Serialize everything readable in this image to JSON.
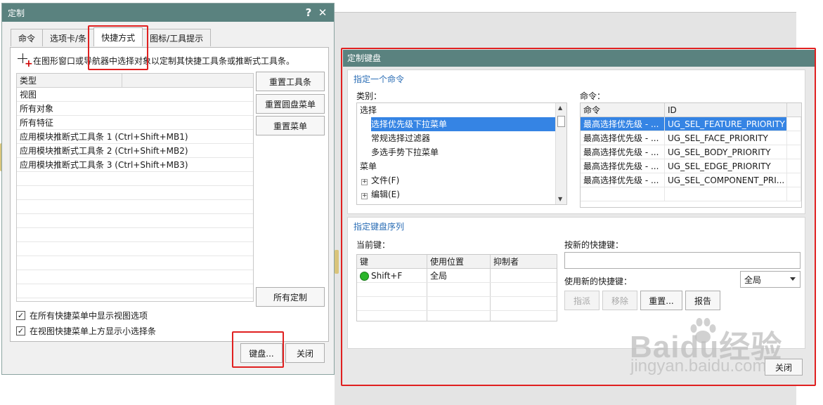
{
  "left_dialog": {
    "title": "定制",
    "help_icon": "?",
    "close_icon": "✕",
    "tabs": [
      "命令",
      "选项卡/条",
      "快捷方式",
      "图标/工具提示"
    ],
    "active_tab": "快捷方式",
    "hint": "在图形窗口或导航器中选择对象以定制其快捷工具条或推断式工具条。",
    "list_header": "类型",
    "list_items": [
      "视图",
      "所有对象",
      "所有特征",
      "应用模块推断式工具条 1 (Ctrl+Shift+MB1)",
      "应用模块推断式工具条 2 (Ctrl+Shift+MB2)",
      "应用模块推断式工具条 3 (Ctrl+Shift+MB3)"
    ],
    "buttons": {
      "reset_toolbar": "重置工具条",
      "reset_radial_menu": "重置圆盘菜单",
      "reset_menu": "重置菜单",
      "all_custom": "所有定制",
      "keyboard": "键盘...",
      "close": "关闭"
    },
    "checkboxes": [
      {
        "label": "在所有快捷菜单中显示视图选项",
        "checked": "✓"
      },
      {
        "label": "在视图快捷菜单上方显示小选择条",
        "checked": "✓"
      }
    ]
  },
  "right_dialog": {
    "title": "定制键盘",
    "assign_group_title": "指定一个命令",
    "category_label": "类别：",
    "command_label": "命令：",
    "tree_items": [
      {
        "text": "选择",
        "level": 0,
        "expander": ""
      },
      {
        "text": "选择优先级下拉菜单",
        "level": 1,
        "expander": "",
        "selected": true
      },
      {
        "text": "常规选择过滤器",
        "level": 1,
        "expander": ""
      },
      {
        "text": "多选手势下拉菜单",
        "level": 1,
        "expander": ""
      },
      {
        "text": "菜单",
        "level": 0,
        "expander": ""
      },
      {
        "text": "文件(F)",
        "level": 1,
        "expander": "+"
      },
      {
        "text": "编辑(E)",
        "level": 1,
        "expander": "+"
      }
    ],
    "cmd_headers": [
      "命令",
      "ID"
    ],
    "commands": [
      {
        "name": "最高选择优先级 - ...",
        "id": "UG_SEL_FEATURE_PRIORITY",
        "selected": true
      },
      {
        "name": "最高选择优先级 - ...",
        "id": "UG_SEL_FACE_PRIORITY"
      },
      {
        "name": "最高选择优先级 - ...",
        "id": "UG_SEL_BODY_PRIORITY"
      },
      {
        "name": "最高选择优先级 - ...",
        "id": "UG_SEL_EDGE_PRIORITY"
      },
      {
        "name": "最高选择优先级 - ...",
        "id": "UG_SEL_COMPONENT_PRI..."
      }
    ],
    "sequence_group_title": "指定键盘序列",
    "current_keys_label": "当前键：",
    "key_headers": [
      "键",
      "使用位置",
      "抑制者"
    ],
    "keys": [
      {
        "key": "Shift+F",
        "location": "全局",
        "suppressor": ""
      }
    ],
    "new_shortcut_label": "按新的快捷键：",
    "new_shortcut_value": "",
    "use_new_label": "使用新的快捷键：",
    "scope_value": "全局",
    "buttons": {
      "assign": "指派",
      "remove": "移除",
      "reset": "重置...",
      "report": "报告",
      "close": "关闭"
    }
  },
  "watermark": {
    "main": "Baidu经验",
    "sub": "jingyan.baidu.com"
  },
  "colors": {
    "titlebar": "#5a827f",
    "selection": "#3584e4",
    "highlight_box": "#e02020",
    "group_title": "#2a6db5"
  }
}
